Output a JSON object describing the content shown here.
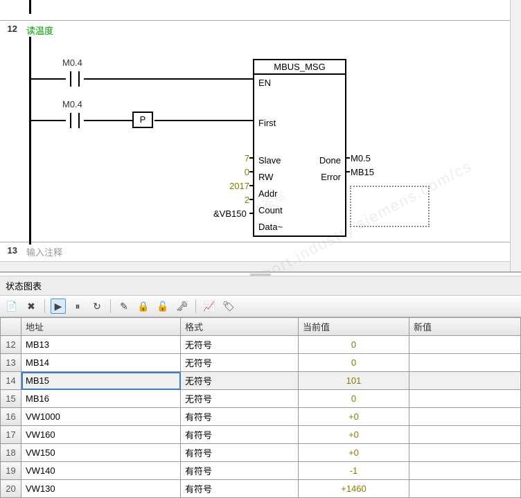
{
  "ladder": {
    "net11": {
      "num": ""
    },
    "net12": {
      "num": "12",
      "comment": "读温度",
      "contact1_label": "M0.4",
      "contact2_label": "M0.4",
      "p_label": "P",
      "block_title": "MBUS_MSG",
      "pins_left": {
        "en": "EN",
        "first": "First",
        "slave": "Slave",
        "rw": "RW",
        "addr": "Addr",
        "count": "Count",
        "data": "Data~"
      },
      "pins_right": {
        "done": "Done",
        "error": "Error"
      },
      "vals": {
        "slave": "7",
        "rw": "0",
        "addr": "2017",
        "count": "2",
        "data": "&VB150",
        "done": "M0.5",
        "error": "MB15"
      }
    },
    "net13": {
      "num": "13",
      "comment": "输入注释"
    }
  },
  "status": {
    "title": "状态图表",
    "headers": {
      "addr": "地址",
      "format": "格式",
      "curval": "当前值",
      "newval": "新值"
    },
    "rows": [
      {
        "n": "12",
        "addr": "MB13",
        "fmt": "无符号",
        "val": "0"
      },
      {
        "n": "13",
        "addr": "MB14",
        "fmt": "无符号",
        "val": "0"
      },
      {
        "n": "14",
        "addr": "MB15",
        "fmt": "无符号",
        "val": "101",
        "sel": true
      },
      {
        "n": "15",
        "addr": "MB16",
        "fmt": "无符号",
        "val": "0"
      },
      {
        "n": "16",
        "addr": "VW1000",
        "fmt": "有符号",
        "val": "+0"
      },
      {
        "n": "17",
        "addr": "VW160",
        "fmt": "有符号",
        "val": "+0"
      },
      {
        "n": "18",
        "addr": "VW150",
        "fmt": "有符号",
        "val": "+0"
      },
      {
        "n": "19",
        "addr": "VW140",
        "fmt": "有符号",
        "val": "-1"
      },
      {
        "n": "20",
        "addr": "VW130",
        "fmt": "有符号",
        "val": "+1460"
      }
    ]
  },
  "watermark": "西门子工业 support.industry.siemens.com/cs",
  "watermark2": "找答案"
}
